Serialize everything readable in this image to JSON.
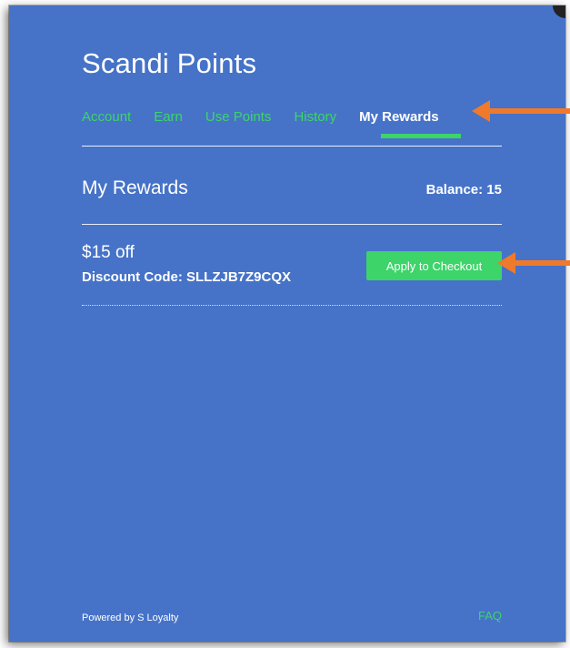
{
  "header": {
    "title": "Scandi Points"
  },
  "tabs": [
    {
      "label": "Account",
      "active": false
    },
    {
      "label": "Earn",
      "active": false
    },
    {
      "label": "Use Points",
      "active": false
    },
    {
      "label": "History",
      "active": false
    },
    {
      "label": "My Rewards",
      "active": true
    }
  ],
  "section": {
    "title": "My Rewards",
    "balance": "Balance: 15"
  },
  "rewards": [
    {
      "title": "$15 off",
      "code": "Discount Code: SLLZJB7Z9CQX",
      "action_label": "Apply to Checkout"
    }
  ],
  "footer": {
    "powered_by": "Powered by S Loyalty",
    "faq_label": "FAQ"
  },
  "colors": {
    "panel_bg": "#4673c8",
    "accent_green": "#3dd46a",
    "annotation_arrow": "#f07a2b"
  }
}
